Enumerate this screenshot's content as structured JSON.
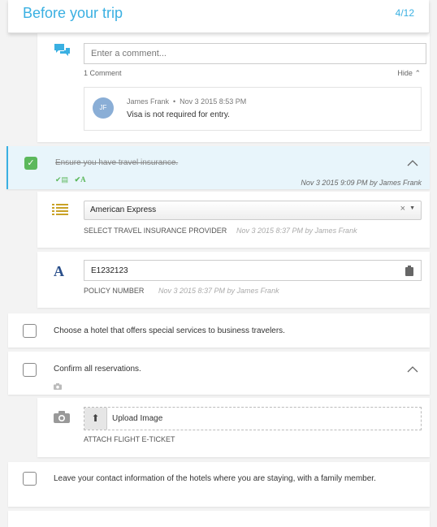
{
  "header": {
    "title": "Before your trip",
    "progress": "4/12"
  },
  "comments": {
    "placeholder": "Enter a comment...",
    "count_label": "1 Comment",
    "hide_label": "Hide",
    "items": [
      {
        "initials": "JF",
        "author": "James Frank",
        "time": "Nov 3 2015 8:53 PM",
        "text": "Visa is not required for entry."
      }
    ]
  },
  "insurance_task": {
    "title": "Ensure you have travel insurance.",
    "checked": true,
    "meta": "Nov 3 2015 9:09 PM by James Frank",
    "provider_field": {
      "value": "American Express",
      "label": "SELECT TRAVEL INSURANCE PROVIDER",
      "meta": "Nov 3 2015 8:37 PM by James Frank"
    },
    "policy_field": {
      "value": "E1232123",
      "label": "POLICY NUMBER",
      "meta": "Nov 3 2015 8:37 PM by James Frank"
    }
  },
  "tasks": [
    {
      "text": "Choose a hotel that offers special services to business travelers.",
      "checked": false
    },
    {
      "text": "Confirm all reservations.",
      "checked": false
    },
    {
      "text": "Leave your contact information of the hotels where you are staying, with a family member.",
      "checked": false
    }
  ],
  "upload_field": {
    "button_label": "Upload Image",
    "label": "ATTACH FLIGHT E-TICKET"
  },
  "colors": {
    "accent": "#3ab0e2",
    "check_green": "#5cb85c",
    "list_icon_gold": "#c9a227",
    "font_icon_navy": "#2a4f8a"
  }
}
